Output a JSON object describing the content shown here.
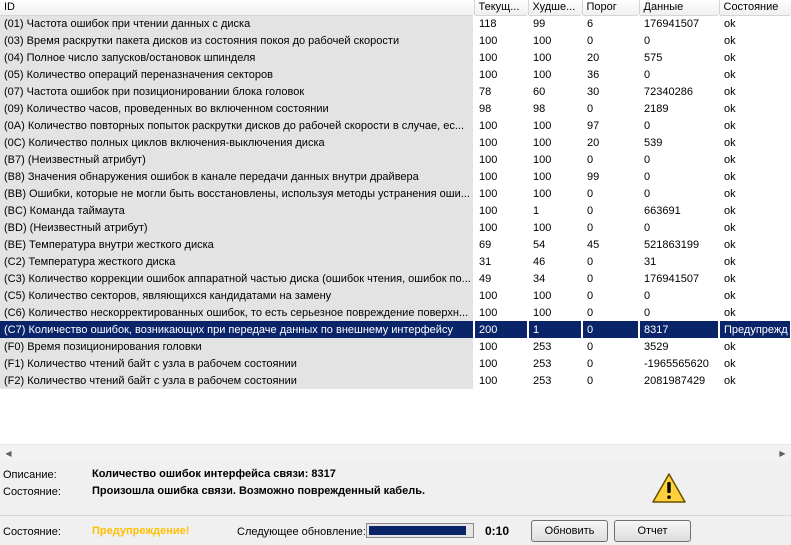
{
  "columns": [
    "ID",
    "Текущ...",
    "Худше...",
    "Порог",
    "Данные",
    "Состояние"
  ],
  "rows": [
    [
      "(01) Частота ошибок при чтении данных с диска",
      "118",
      "99",
      "6",
      "176941507",
      "ok"
    ],
    [
      "(03) Время раскрутки пакета дисков из состояния покоя до рабочей скорости",
      "100",
      "100",
      "0",
      "0",
      "ok"
    ],
    [
      "(04) Полное число запусков/остановок шпинделя",
      "100",
      "100",
      "20",
      "575",
      "ok"
    ],
    [
      "(05) Количество операций переназначения секторов",
      "100",
      "100",
      "36",
      "0",
      "ok"
    ],
    [
      "(07) Частота ошибок при позиционировании блока головок",
      "78",
      "60",
      "30",
      "72340286",
      "ok"
    ],
    [
      "(09) Количество часов, проведенных во включенном состоянии",
      "98",
      "98",
      "0",
      "2189",
      "ok"
    ],
    [
      "(0A) Количество повторных попыток раскрутки дисков до рабочей скорости в случае, ес...",
      "100",
      "100",
      "97",
      "0",
      "ok"
    ],
    [
      "(0C) Количество полных циклов включения-выключения диска",
      "100",
      "100",
      "20",
      "539",
      "ok"
    ],
    [
      "(B7) (Неизвестный атрибут)",
      "100",
      "100",
      "0",
      "0",
      "ok"
    ],
    [
      "(B8) Значения обнаружения ошибок в канале передачи данных внутри драйвера",
      "100",
      "100",
      "99",
      "0",
      "ok"
    ],
    [
      "(BB) Ошибки, которые не могли быть восстановлены, используя методы устранения оши...",
      "100",
      "100",
      "0",
      "0",
      "ok"
    ],
    [
      "(BC) Команда таймаута",
      "100",
      "1",
      "0",
      "663691",
      "ok"
    ],
    [
      "(BD) (Неизвестный атрибут)",
      "100",
      "100",
      "0",
      "0",
      "ok"
    ],
    [
      "(BE) Температура внутри жесткого диска",
      "69",
      "54",
      "45",
      "521863199",
      "ok"
    ],
    [
      "(C2) Температура жесткого диска",
      "31",
      "46",
      "0",
      "31",
      "ok"
    ],
    [
      "(C3) Количество коррекции ошибок аппаратной частью диска (ошибок чтения, ошибок по...",
      "49",
      "34",
      "0",
      "176941507",
      "ok"
    ],
    [
      "(C5) Количество секторов, являющихся кандидатами на замену",
      "100",
      "100",
      "0",
      "0",
      "ok"
    ],
    [
      "(C6) Количество нескорректированных ошибок, то есть серьезное повреждение поверхн...",
      "100",
      "100",
      "0",
      "0",
      "ok"
    ],
    [
      "(C7) Количество ошибок, возникающих при передаче данных по внешнему интерфейсу",
      "200",
      "1",
      "0",
      "8317",
      "Предупрежд"
    ],
    [
      "(F0) Время позиционирования головки",
      "100",
      "253",
      "0",
      "3529",
      "ok"
    ],
    [
      "(F1) Количество чтений байт с узла в рабочем состоянии",
      "100",
      "253",
      "0",
      "-1965565620",
      "ok"
    ],
    [
      "(F2) Количество чтений байт с узла в рабочем состоянии",
      "100",
      "253",
      "0",
      "2081987429",
      "ok"
    ]
  ],
  "selected_row": 18,
  "details": {
    "description_label": "Описание:",
    "description_value": "Количество ошибок интерфейса связи: 8317",
    "state_label": "Состояние:",
    "state_value": "Произошла ошибка связи. Возможно поврежденный кабель."
  },
  "status": {
    "label": "Состояние:",
    "value": "Предупреждение!",
    "value_color": "#ffc000",
    "next_update_label": "Следующее обновление:",
    "progress_fraction": 0.95,
    "timer": "0:10"
  },
  "buttons": {
    "refresh": "Обновить",
    "report": "Отчет"
  },
  "icons": {
    "warning": "warning-icon",
    "scroll_left": "arrow-left-icon",
    "scroll_right": "arrow-right-icon"
  }
}
